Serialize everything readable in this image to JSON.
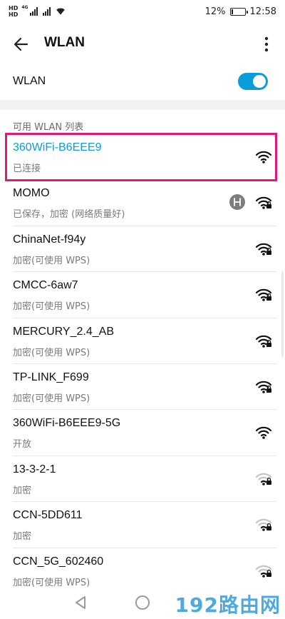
{
  "status_bar": {
    "hd_top": "HD",
    "hd_bottom": "HD",
    "net_type": "4G",
    "battery_percent": "12%",
    "battery_level": 0.12,
    "time": "12:58"
  },
  "header": {
    "title": "WLAN",
    "back_icon": "arrow-left-icon",
    "menu_icon": "more-vertical-icon"
  },
  "wlan_toggle": {
    "label": "WLAN",
    "enabled": true,
    "accent": "#0a9ddb"
  },
  "section_label": "可用 WLAN 列表",
  "networks": [
    {
      "name": "360WiFi-B6EEE9",
      "status": "已连接",
      "locked": false,
      "strength": "full",
      "connected": true
    },
    {
      "name": "MOMO",
      "status": "已保存，加密 (网络质量好)",
      "locked": true,
      "strength": "full",
      "has_extra_icon": true,
      "extra_icon": "hotspot-badge-icon"
    },
    {
      "name": "ChinaNet-f94y",
      "status": "加密(可使用 WPS)",
      "locked": true,
      "strength": "full"
    },
    {
      "name": "CMCC-6aw7",
      "status": "加密(可使用 WPS)",
      "locked": true,
      "strength": "full"
    },
    {
      "name": "MERCURY_2.4_AB",
      "status": "加密(可使用 WPS)",
      "locked": true,
      "strength": "full"
    },
    {
      "name": "TP-LINK_F699",
      "status": "加密(可使用 WPS)",
      "locked": true,
      "strength": "full"
    },
    {
      "name": "360WiFi-B6EEE9-5G",
      "status": "开放",
      "locked": false,
      "strength": "full"
    },
    {
      "name": "13-3-2-1",
      "status": "加密",
      "locked": true,
      "strength": "weak"
    },
    {
      "name": "CCN-5DD611",
      "status": "加密",
      "locked": true,
      "strength": "weak"
    },
    {
      "name": "CCN_5G_602460",
      "status": "加密(可使用 WPS)",
      "locked": true,
      "strength": "weak"
    }
  ],
  "highlight_color": "#e0197d",
  "nav_bar": {
    "back_icon": "triangle-back-icon",
    "home_icon": "circle-home-icon"
  },
  "watermark": "192路由网"
}
